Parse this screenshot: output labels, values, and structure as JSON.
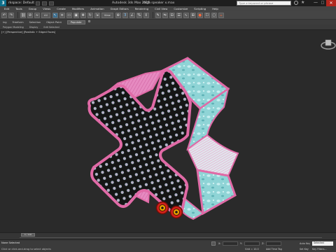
{
  "titlebar": {
    "logo": "3",
    "workspace": "rkspace: Default",
    "app_title": "Autodesk 3ds Max 2015",
    "file_name": "high speaker x.max",
    "search_placeholder": "Type a keyword or phrase",
    "min": "—",
    "max": "□",
    "close": "✕"
  },
  "menu": [
    "Edit",
    "Tools",
    "Group",
    "Views",
    "Create",
    "Modifiers",
    "Animation",
    "Graph Editors",
    "Rendering",
    "Civil View",
    "Customize",
    "Scripting",
    "Help"
  ],
  "toolbar": {
    "selection_filter": "All",
    "view_dropdown": "View",
    "icons": [
      "undo-icon",
      "redo-icon",
      "link-icon",
      "unlink-icon",
      "bind-icon",
      "select-icon",
      "select-by-name-icon",
      "region-icon",
      "window-crossing-icon",
      "move-icon",
      "rotate-icon",
      "scale-icon",
      "pivot-icon",
      "snap-icon",
      "angle-snap-icon",
      "percent-snap-icon",
      "spinner-snap-icon",
      "named-selection-icon",
      "mirror-icon",
      "align-icon",
      "layers-icon",
      "curve-editor-icon",
      "schematic-icon",
      "material-editor-icon",
      "render-setup-icon",
      "render-frame-icon",
      "render-icon"
    ]
  },
  "ribbon": {
    "tabs": [
      "ing",
      "Freeform",
      "Selection",
      "Object Paint"
    ],
    "populate_label": "Populate",
    "gear": "⚙"
  },
  "ribbon2": [
    "Polygon Modeling",
    "Display",
    "Edit Selected"
  ],
  "viewport": {
    "label": "[+] [Perspective] [Realistic + Edged Faces]"
  },
  "timeline": {
    "slider_label": "0 / 100"
  },
  "status": {
    "selection": "None Selected",
    "prompt": "Click or click-and-drag to select objects",
    "x_label": "X:",
    "y_label": "Y:",
    "z_label": "Z:",
    "grid": "Grid = 10.0",
    "auto_key": "Auto Key",
    "set_key": "Set Key",
    "key_filter": "Selected",
    "key_filters": "Key Filters...",
    "add_time_tag": "Add Time Tag"
  },
  "colors": {
    "accent": "#3a6f91",
    "object_pink": "#e56fb0",
    "object_cyan": "#8fd6d8",
    "close_red": "#b3271e"
  }
}
